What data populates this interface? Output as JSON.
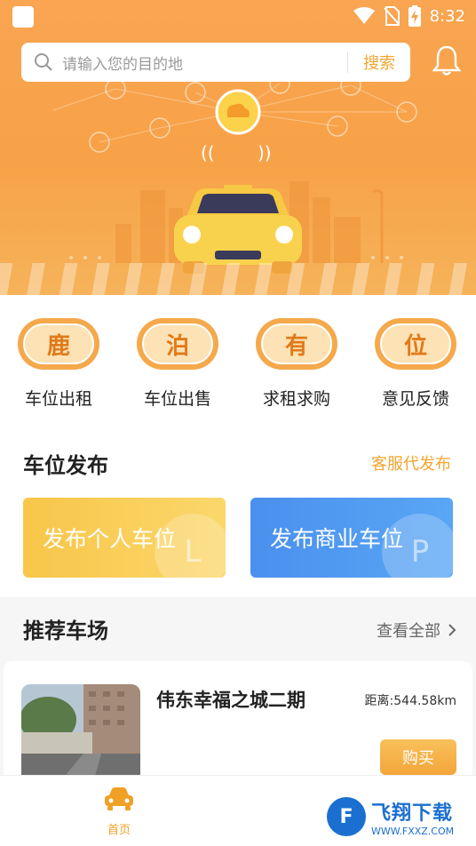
{
  "status_bar": {
    "time": "8:32"
  },
  "search": {
    "placeholder": "请输入您的目的地",
    "button": "搜索"
  },
  "shortcuts": [
    {
      "glyph": "鹿",
      "label": "车位出租"
    },
    {
      "glyph": "泊",
      "label": "车位出售"
    },
    {
      "glyph": "有",
      "label": "求租求购"
    },
    {
      "glyph": "位",
      "label": "意见反馈"
    }
  ],
  "publish": {
    "title": "车位发布",
    "service_link": "客服代发布",
    "personal": "发布个人车位",
    "commercial": "发布商业车位"
  },
  "recommend": {
    "title": "推荐车场",
    "view_all": "查看全部",
    "lot": {
      "name": "伟东幸福之城二期",
      "distance": "距离:544.58km",
      "buy": "购买"
    }
  },
  "tabbar": {
    "home": "首页"
  },
  "watermark": {
    "main": "飞翔下载",
    "sub": "WWW.FXXZ.COM"
  },
  "colors": {
    "accent": "#f3a530",
    "personal_card": "#f8c64a",
    "commercial_card": "#4a96f0"
  }
}
